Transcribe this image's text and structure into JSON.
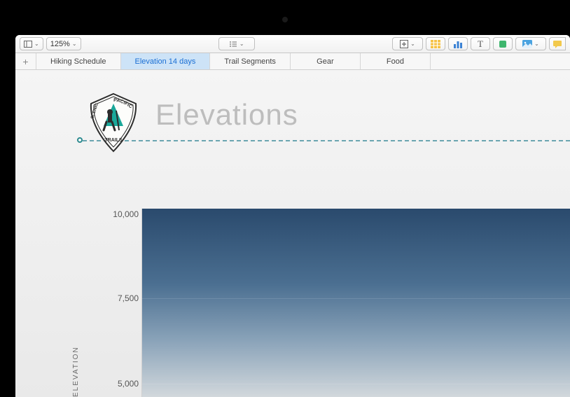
{
  "toolbar": {
    "zoom": "125%"
  },
  "tabs": [
    {
      "label": "Hiking Schedule"
    },
    {
      "label": "Elevation 14 days"
    },
    {
      "label": "Trail Segments"
    },
    {
      "label": "Gear"
    },
    {
      "label": "Food"
    }
  ],
  "active_tab_index": 1,
  "page": {
    "title": "Elevations",
    "badge_top": "PACIFIC",
    "badge_left": "SCENIC",
    "badge_bottom": "TRAILS"
  },
  "chart_data": {
    "type": "area",
    "title": "",
    "xlabel": "",
    "ylabel": "ELEVATION",
    "ylim": [
      5000,
      10000
    ],
    "y_ticks": [
      "10,000",
      "7,500",
      "5,000"
    ]
  }
}
